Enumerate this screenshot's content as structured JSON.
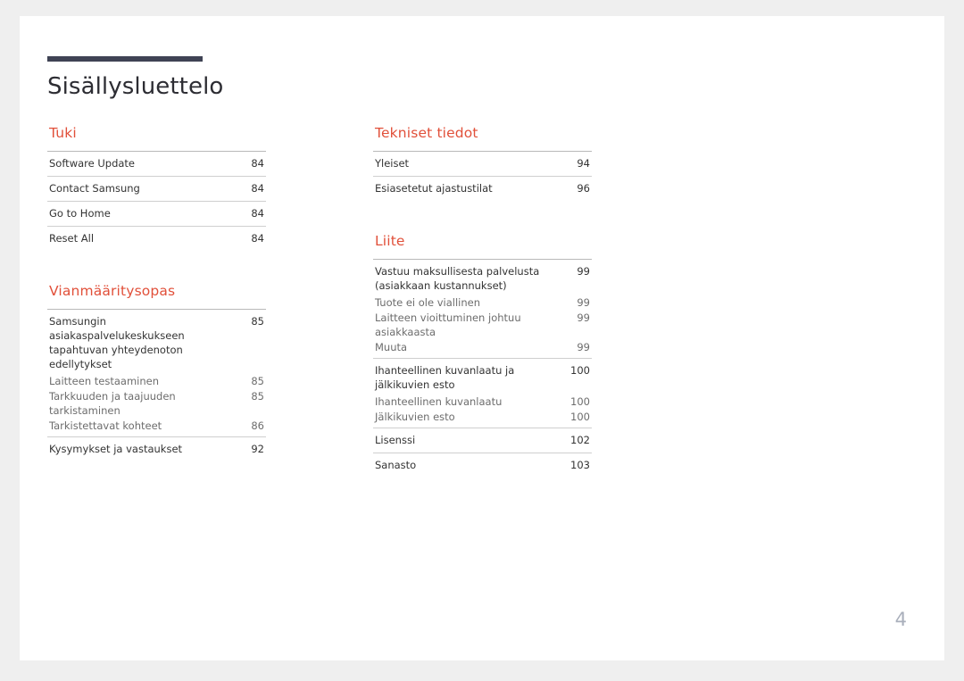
{
  "document": {
    "title": "Sisällysluettelo",
    "page_number": "4",
    "accent_color": "#e1503a",
    "rule_color": "#3f4354"
  },
  "left_column": {
    "sections": [
      {
        "heading": "Tuki",
        "groups": [
          {
            "entries": [
              {
                "label": "Software Update",
                "page": "84",
                "sub": false
              }
            ]
          },
          {
            "entries": [
              {
                "label": "Contact Samsung",
                "page": "84",
                "sub": false
              }
            ]
          },
          {
            "entries": [
              {
                "label": "Go to Home",
                "page": "84",
                "sub": false
              }
            ]
          },
          {
            "entries": [
              {
                "label": "Reset All",
                "page": "84",
                "sub": false
              }
            ]
          }
        ]
      },
      {
        "heading": "Vianmääritysopas",
        "groups": [
          {
            "entries": [
              {
                "label": "Samsungin asiakaspalvelukeskukseen tapahtuvan yhteydenoton edellytykset",
                "page": "85",
                "sub": false
              },
              {
                "label": "Laitteen testaaminen",
                "page": "85",
                "sub": true
              },
              {
                "label": "Tarkkuuden ja taajuuden tarkistaminen",
                "page": "85",
                "sub": true
              },
              {
                "label": "Tarkistettavat kohteet",
                "page": "86",
                "sub": true
              }
            ]
          },
          {
            "entries": [
              {
                "label": "Kysymykset ja vastaukset",
                "page": "92",
                "sub": false
              }
            ]
          }
        ]
      }
    ]
  },
  "right_column": {
    "sections": [
      {
        "heading": "Tekniset tiedot",
        "groups": [
          {
            "entries": [
              {
                "label": "Yleiset",
                "page": "94",
                "sub": false
              }
            ]
          },
          {
            "entries": [
              {
                "label": "Esiasetetut ajastustilat",
                "page": "96",
                "sub": false
              }
            ]
          }
        ]
      },
      {
        "heading": "Liite",
        "groups": [
          {
            "entries": [
              {
                "label": "Vastuu maksullisesta palvelusta (asiakkaan kustannukset)",
                "page": "99",
                "sub": false
              },
              {
                "label": "Tuote ei ole viallinen",
                "page": "99",
                "sub": true
              },
              {
                "label": "Laitteen vioittuminen johtuu asiakkaasta",
                "page": "99",
                "sub": true
              },
              {
                "label": "Muuta",
                "page": "99",
                "sub": true
              }
            ]
          },
          {
            "entries": [
              {
                "label": "Ihanteellinen kuvanlaatu ja jälkikuvien esto",
                "page": "100",
                "sub": false
              },
              {
                "label": "Ihanteellinen kuvanlaatu",
                "page": "100",
                "sub": true
              },
              {
                "label": "Jälkikuvien esto",
                "page": "100",
                "sub": true
              }
            ]
          },
          {
            "entries": [
              {
                "label": "Lisenssi",
                "page": "102",
                "sub": false
              }
            ]
          },
          {
            "entries": [
              {
                "label": "Sanasto",
                "page": "103",
                "sub": false
              }
            ]
          }
        ]
      }
    ]
  }
}
